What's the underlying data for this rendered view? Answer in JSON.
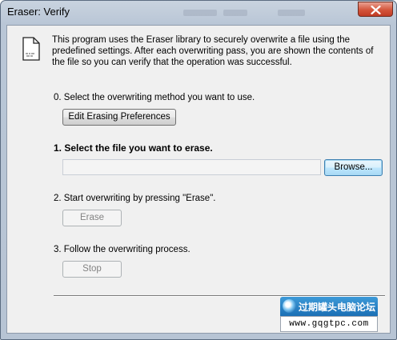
{
  "window": {
    "title": "Eraser: Verify"
  },
  "intro": {
    "text": "This program uses the Eraser library to securely overwrite a file using the predefined settings. After each overwriting pass, you are shown the contents of the file so you can verify that the operation was successful."
  },
  "steps": {
    "step0": {
      "label": "0. Select the overwriting method you want to use.",
      "button": "Edit Erasing Preferences"
    },
    "step1": {
      "label": "1. Select the file you want to erase.",
      "file_value": "",
      "browse_button": "Browse..."
    },
    "step2": {
      "label": "2. Start overwriting by pressing \"Erase\".",
      "button": "Erase"
    },
    "step3": {
      "label": "3. Follow the overwriting process.",
      "button": "Stop"
    }
  },
  "watermark": {
    "site_name": "过期罐头电脑论坛",
    "url": "www.gqgtpc.com"
  },
  "icons": {
    "document": "document-icon",
    "close": "close-icon",
    "logo": "forum-logo-icon"
  }
}
